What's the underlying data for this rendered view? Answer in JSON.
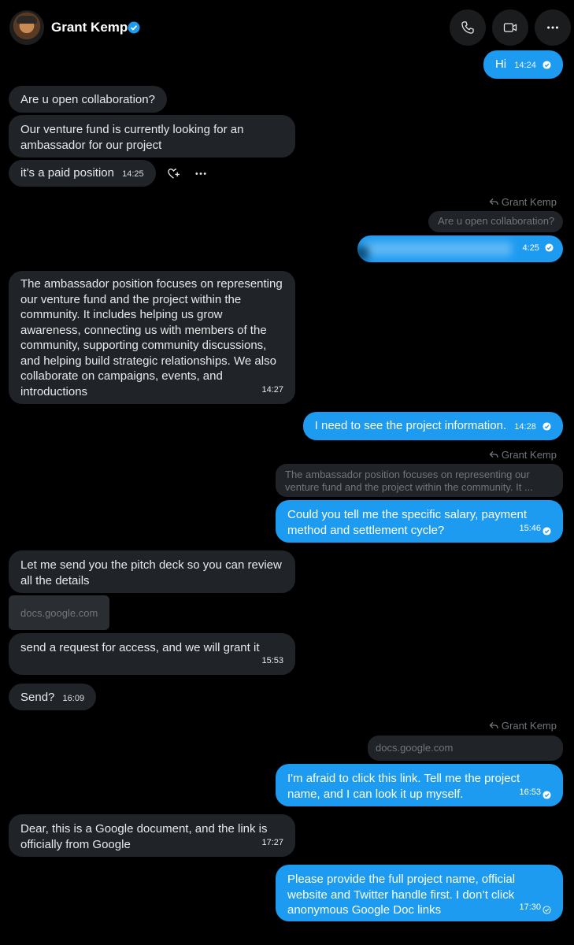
{
  "header": {
    "contact_name": "Grant Kemp"
  },
  "messages": {
    "m1": {
      "text": "Hi",
      "time": "14:24"
    },
    "m2": {
      "text": "Are u open collaboration?"
    },
    "m3": {
      "line1": "Our venture fund is currently looking for an",
      "line2": "ambassador for our project"
    },
    "m4": {
      "text": "it’s a paid position",
      "time": "14:25"
    },
    "m5": {
      "reply_to": "Grant Kemp",
      "quote": "Are u open collaboration?",
      "time": "4:25"
    },
    "m6": {
      "lines": [
        "The ambassador position focuses on representing",
        "our venture fund and the project within the",
        "community. It includes helping us grow",
        "awareness, connecting us with members of the",
        "community, supporting community discussions,",
        "and helping build strategic relationships. We also",
        "collaborate on campaigns, events, and",
        "introductions"
      ],
      "time": "14:27"
    },
    "m7": {
      "text": "I need to see the project information.",
      "time": "14:28"
    },
    "m8": {
      "reply_to": "Grant Kemp",
      "quote_line1": "The ambassador position focuses on representing our",
      "quote_line2": "venture fund and the project within the community. It ...",
      "line1": "Could you tell me the specific salary, payment",
      "line2": "method and settlement cycle?",
      "time": "15:46"
    },
    "m9": {
      "line1": "Let me send you the pitch deck so you can review",
      "line2": "all the details"
    },
    "m10": {
      "link": "docs.google.com"
    },
    "m11": {
      "text": "send a request for access, and we will grant it",
      "time": "15:53"
    },
    "m12": {
      "text": "Send?",
      "time": "16:09"
    },
    "m13": {
      "reply_to": "Grant Kemp",
      "quote": "docs.google.com",
      "line1": "I'm afraid to click this link. Tell me the project",
      "line2": "name, and I can look it up myself.",
      "time": "16:53"
    },
    "m14": {
      "line1": "Dear, this is a Google document, and the link is",
      "line2": "officially from Google",
      "time": "17:27"
    },
    "m15": {
      "line1": "Please provide the full project name, official",
      "line2": "website and Twitter handle first. I don’t click",
      "line3": "anonymous Google Doc links",
      "time": "17:30"
    }
  },
  "colors": {
    "incoming_bubble": "#202327",
    "outgoing_bubble": "#1d9bf0",
    "background": "#000000",
    "muted_text": "#71767b"
  }
}
